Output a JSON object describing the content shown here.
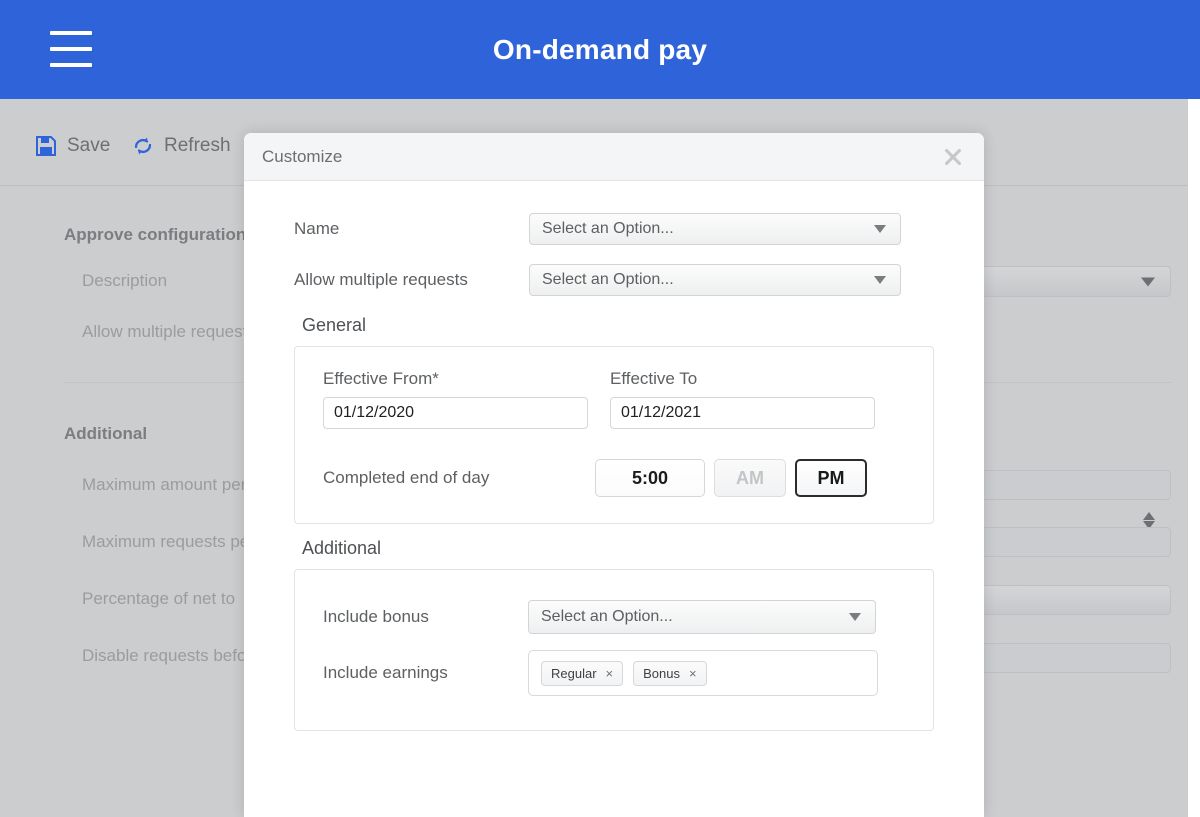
{
  "app": {
    "title": "On-demand pay",
    "menu_icon": "hamburger-menu-icon",
    "header_bg": "#2f63da"
  },
  "toolbar": {
    "save_label": "Save",
    "save_icon": "floppy-disk-save-icon",
    "refresh_label": "Refresh",
    "refresh_icon": "circular-arrows-refresh-icon",
    "icon_color": "#2f63da"
  },
  "background_page": {
    "sections": [
      {
        "title": "Approve configuration",
        "fields": [
          "Description",
          "Allow multiple requests"
        ]
      },
      {
        "title": "Additional",
        "fields": [
          "Maximum amount per request",
          "Maximum requests per period",
          "Percentage of net to",
          "Disable requests before"
        ]
      }
    ]
  },
  "modal": {
    "title": "Customize",
    "close_icon": "close-x-icon",
    "top_fields": [
      {
        "label": "Name",
        "value": "Select an Option...",
        "type": "select"
      },
      {
        "label": "Allow multiple requests",
        "value": "Select an Option...",
        "type": "select"
      }
    ],
    "general": {
      "title": "General",
      "effective_from": {
        "label": "Effective From*",
        "value": "01/12/2020"
      },
      "effective_to": {
        "label": "Effective To",
        "value": "01/12/2021"
      },
      "completed": {
        "label": "Completed end of day",
        "time": "5:00",
        "am_label": "AM",
        "pm_label": "PM",
        "selected_meridiem": "PM"
      }
    },
    "additional": {
      "title": "Additional",
      "include_bonus": {
        "label": "Include bonus",
        "value": "Select an Option...",
        "type": "select"
      },
      "include_earnings": {
        "label": "Include earnings",
        "tags": [
          {
            "text": "Regular",
            "remove": "×"
          },
          {
            "text": "Bonus",
            "remove": "×"
          }
        ]
      }
    }
  }
}
